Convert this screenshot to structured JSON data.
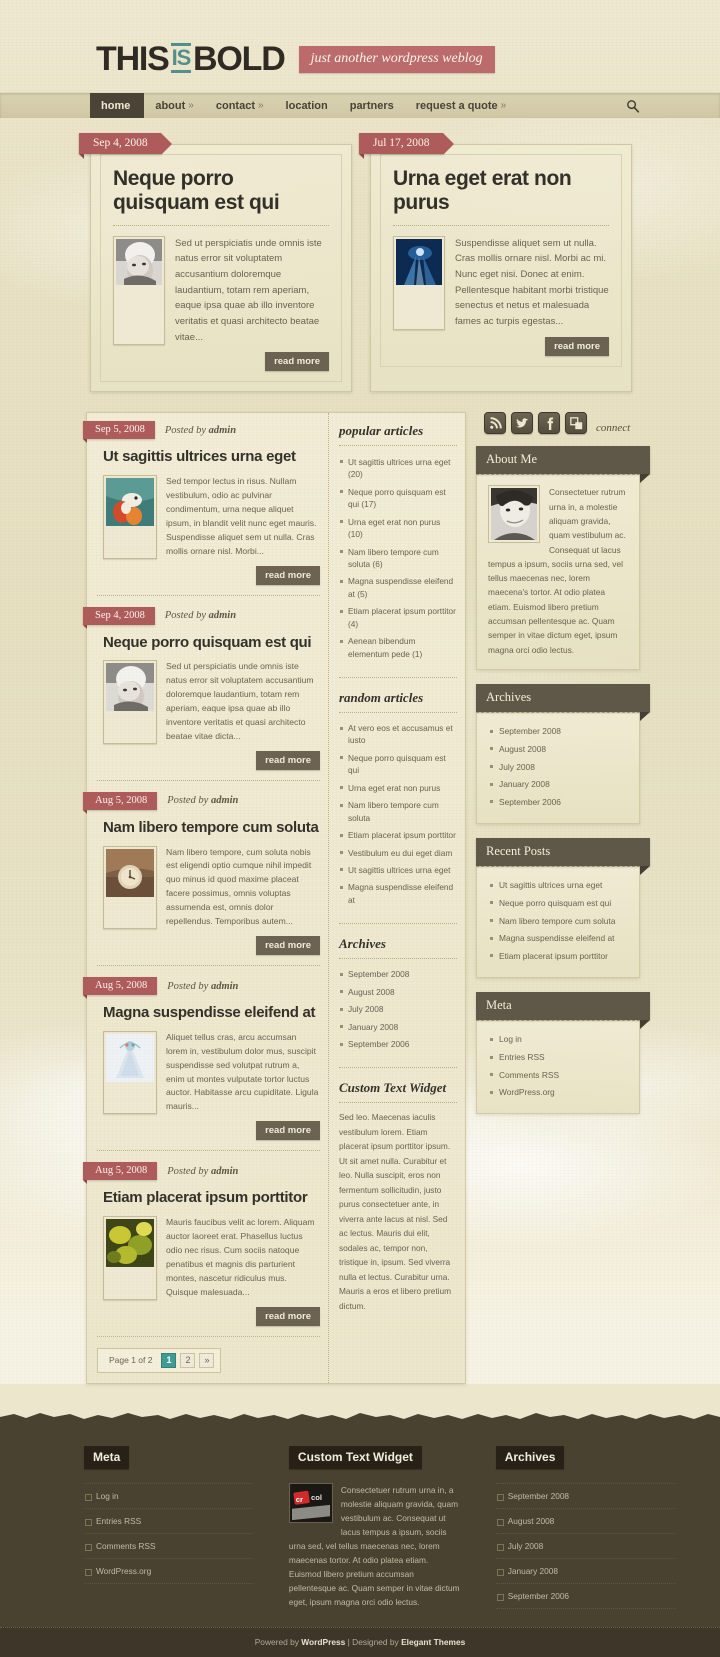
{
  "header": {
    "logo_part1": "THIS",
    "logo_is": "IS",
    "logo_part2": "BOLD",
    "tagline": "just another wordpress weblog",
    "search_icon": "search-icon"
  },
  "nav": {
    "items": [
      {
        "label": "home",
        "caret": "",
        "active": true
      },
      {
        "label": "about",
        "caret": "»",
        "active": false
      },
      {
        "label": "contact",
        "caret": "»",
        "active": false
      },
      {
        "label": "location",
        "caret": "",
        "active": false
      },
      {
        "label": "partners",
        "caret": "",
        "active": false
      },
      {
        "label": "request a quote",
        "caret": "»",
        "active": false
      }
    ]
  },
  "featured": [
    {
      "date": "Sep 4, 2008",
      "title": "Neque porro quisquam est qui",
      "excerpt": "Sed ut perspiciatis unde omnis iste natus error sit voluptatem accusantium doloremque laudantium, totam rem aperiam, eaque ipsa quae ab illo inventore veritatis et quasi architecto beatae vitae...",
      "read_more": "read more",
      "thumb": "portrait-bw-woman-looking-up"
    },
    {
      "date": "Jul 17, 2008",
      "title": "Urna eget erat non purus",
      "excerpt": "Suspendisse aliquet sem ut nulla. Cras mollis ornare nisl. Morbi ac mi. Nunc eget nisi. Donec at enim. Pellentesque habitant morbi tristique senectus et netus et malesuada fames ac turpis egestas...",
      "read_more": "read more",
      "thumb": "blue-underwater-light"
    }
  ],
  "posts": [
    {
      "date": "Sep 5, 2008",
      "posted_by_prefix": "Posted by ",
      "author": "admin",
      "title": "Ut sagittis ultrices urna eget",
      "excerpt": "Sed tempor lectus in risus. Nullam vestibulum, odio ac pulvinar condimentum, urna neque aliquet ipsum, in blandit velit nunc eget mauris. Suspendisse aliquet sem ut nulla. Cras mollis ornare nisl. Morbi...",
      "read_more": "read more",
      "thumb": "koi-fish-painting"
    },
    {
      "date": "Sep 4, 2008",
      "posted_by_prefix": "Posted by ",
      "author": "admin",
      "title": "Neque porro quisquam est qui",
      "excerpt": "Sed ut perspiciatis unde omnis iste natus error sit voluptatem accusantium doloremque laudantium, totam rem aperiam, eaque ipsa quae ab illo inventore veritatis et quasi architecto beatae vitae dicta...",
      "read_more": "read more",
      "thumb": "portrait-bw-woman-looking-up"
    },
    {
      "date": "Aug 5, 2008",
      "posted_by_prefix": "Posted by ",
      "author": "admin",
      "title": "Nam libero tempore cum soluta",
      "excerpt": "Nam libero tempore, cum soluta nobis est eligendi optio cumque nihil impedit quo minus id quod maxime placeat facere possimus, omnis voluptas assumenda est, omnis dolor repellendus. Temporibus autem...",
      "read_more": "read more",
      "thumb": "vintage-sepia-clock"
    },
    {
      "date": "Aug 5, 2008",
      "posted_by_prefix": "Posted by ",
      "author": "admin",
      "title": "Magna suspendisse eleifend at",
      "excerpt": "Aliquet tellus cras, arcu accumsan lorem in, vestibulum dolor mus, suscipit suspendisse sed volutpat rutrum a, enim ut montes vulputate tortor luctus auctor. Habitasse arcu cupiditate. Ligula mauris...",
      "read_more": "read more",
      "thumb": "pale-blue-illustration"
    },
    {
      "date": "Aug 5, 2008",
      "posted_by_prefix": "Posted by ",
      "author": "admin",
      "title": "Etiam placerat ipsum porttitor",
      "excerpt": "Mauris faucibus velit ac lorem. Aliquam auctor laoreet erat. Phasellus luctus odio nec risus. Cum sociis natoque penatibus et magnis dis parturient montes, nascetur ridiculus mus. Quisque malesuada...",
      "read_more": "read more",
      "thumb": "yellow-green-foliage"
    }
  ],
  "pagination": {
    "label": "Page 1 of 2",
    "pages": [
      "1",
      "2",
      "»"
    ],
    "active_index": 0,
    "active_color": "#3f9c95"
  },
  "inner_sidebar": {
    "popular": {
      "title": "popular articles",
      "items": [
        "Ut sagittis ultrices urna eget (20)",
        "Neque porro quisquam est qui (17)",
        "Urna eget erat non purus (10)",
        "Nam libero tempore cum soluta (6)",
        "Magna suspendisse eleifend at (5)",
        "Etiam placerat ipsum porttitor (4)",
        "Aenean bibendum elementum pede (1)"
      ]
    },
    "random": {
      "title": "random articles",
      "items": [
        "At vero eos et accusamus et iusto",
        "Neque porro quisquam est qui",
        "Urna eget erat non purus",
        "Nam libero tempore cum soluta",
        "Etiam placerat ipsum porttitor",
        "Vestibulum eu dui eget diam",
        "Ut sagittis ultrices urna eget",
        "Magna suspendisse eleifend at"
      ]
    },
    "archives": {
      "title": "Archives",
      "items": [
        "September 2008",
        "August 2008",
        "July 2008",
        "January 2008",
        "September 2006"
      ]
    },
    "custom_text": {
      "title": "Custom Text Widget",
      "text": "Sed leo. Maecenas iaculis vestibulum lorem. Etiam placerat ipsum porttitor ipsum. Ut sit amet nulla. Curabitur et leo. Nulla suscipit, eros non fermentum sollicitudin, justo purus consectetuer ante, in viverra ante lacus at nisl. Sed ac lectus. Mauris dui elit, sodales ac, tempor non, tristique in, ipsum. Sed viverra nulla et lectus. Curabitur urna. Mauris a eros et libero pretium dictum."
    }
  },
  "sidebar": {
    "social": {
      "icons": [
        "rss-icon",
        "twitter-icon",
        "facebook-icon",
        "share-icon"
      ],
      "connect_label": "connect"
    },
    "about": {
      "title": "About Me",
      "avatar": "portrait-bw-person",
      "text": "Consectetuer rutrum urna in, a molestie aliquam gravida, quam vestibulum ac. Consequat ut lacus tempus a ipsum, sociis urna sed, vel tellus maecenas nec, lorem maecena's tortor. At odio platea etiam. Euismod libero pretium accumsan pellentesque ac. Quam semper in vitae dictum eget, ipsum magna orci odio lectus."
    },
    "archives": {
      "title": "Archives",
      "items": [
        "September 2008",
        "August 2008",
        "July 2008",
        "January 2008",
        "September 2006"
      ]
    },
    "recent_posts": {
      "title": "Recent Posts",
      "items": [
        "Ut sagittis ultrices urna eget",
        "Neque porro quisquam est qui",
        "Nam libero tempore cum soluta",
        "Magna suspendisse eleifend at",
        "Etiam placerat ipsum porttitor"
      ]
    },
    "meta": {
      "title": "Meta",
      "items": [
        "Log in",
        "Entries RSS",
        "Comments RSS",
        "WordPress.org"
      ]
    }
  },
  "footer": {
    "meta": {
      "title": "Meta",
      "items": [
        "Log in",
        "Entries RSS",
        "Comments RSS",
        "WordPress.org"
      ]
    },
    "custom_text": {
      "title": "Custom Text Widget",
      "image": "red-black-logo-thumb",
      "text": "Consectetuer rutrum urna in, a molestie aliquam gravida, quam vestibulum ac. Consequat ut lacus tempus a ipsum, sociis urna sed, vel tellus maecenas nec, lorem maecenas tortor. At odio platea etiam. Euismod libero pretium accumsan pellentesque ac. Quam semper in vitae dictum eget, ipsum magna orci odio lectus."
    },
    "archives": {
      "title": "Archives",
      "items": [
        "September 2008",
        "August 2008",
        "July 2008",
        "January 2008",
        "September 2006"
      ]
    },
    "credits_prefix": "Powered by ",
    "credits_wp": "WordPress",
    "credits_mid": " | Designed by ",
    "credits_et": "Elegant Themes"
  },
  "colors": {
    "brand_red": "#ad5b5b",
    "accent_teal": "#53908b",
    "dark_brown": "#4a4231",
    "paper": "#e8e1c4"
  }
}
